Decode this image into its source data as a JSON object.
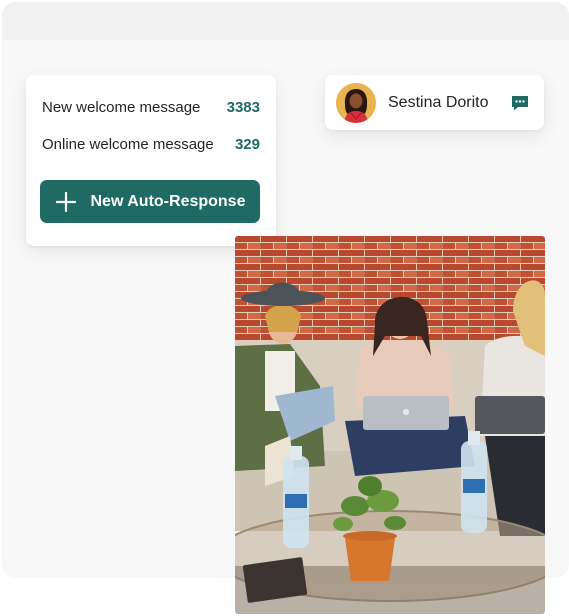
{
  "auto_responses": {
    "items": [
      {
        "label": "New welcome message",
        "count": "3383"
      },
      {
        "label": "Online welcome message",
        "count": "329"
      }
    ],
    "new_button_label": "New Auto-Response"
  },
  "contact": {
    "name": "Sestina Dorito",
    "avatar_icon": "avatar-illustration",
    "action_icon": "chat-bubble-icon"
  },
  "colors": {
    "accent": "#1f6b63",
    "panel_bg": "#f8f8f8",
    "card_bg": "#ffffff"
  }
}
